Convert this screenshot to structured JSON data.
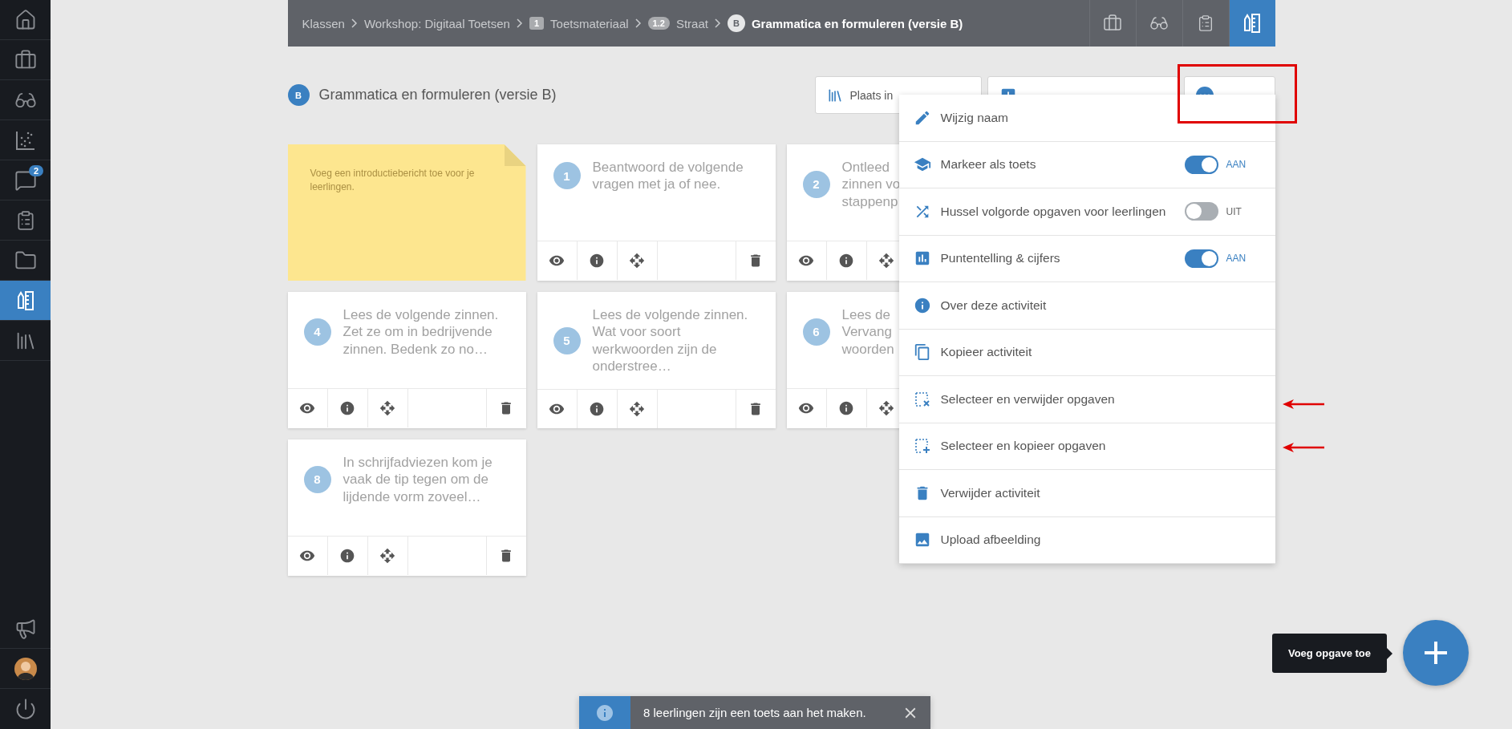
{
  "sidebar": {
    "items": [
      {
        "selected": false
      },
      {
        "selected": false
      },
      {
        "selected": false
      },
      {
        "selected": false
      },
      {
        "selected": false,
        "badge": "2"
      },
      {
        "selected": false
      },
      {
        "selected": false
      },
      {
        "selected": true
      },
      {
        "selected": false
      }
    ]
  },
  "header": {
    "breadcrumb": [
      {
        "label": "Klassen"
      },
      {
        "label": "Workshop: Digitaal Toetsen"
      },
      {
        "kind": "tag",
        "badge": "1",
        "label": "Toetsmateriaal"
      },
      {
        "kind": "tag",
        "badge": "1.2",
        "label": "Straat"
      },
      {
        "kind": "letter",
        "badge": "B",
        "label": "Grammatica en formuleren (versie B)",
        "current": true
      }
    ],
    "tools": [
      {
        "selected": false
      },
      {
        "selected": false
      },
      {
        "selected": false
      },
      {
        "selected": true
      }
    ]
  },
  "activity": {
    "badge": "B",
    "title": "Grammatica en formuleren (versie B)"
  },
  "actions": [
    {
      "label": "Plaats in"
    }
  ],
  "note": {
    "text": "Voeg een introductiebericht toe voor je leerlingen."
  },
  "cards": [
    {
      "number": "1",
      "text": "Beantwoord de volgende\nvragen met ja of nee."
    },
    {
      "number": "2",
      "text": "Ontleed\nzinnen vo\nstappenp"
    },
    {
      "number": "4",
      "text": "Lees de volgende zinnen.\nZet ze om in bedrijvende\nzinnen. Bedenk zo no…"
    },
    {
      "number": "5",
      "text": "Lees de volgende zinnen.\nWat voor soort\nwerkwoorden zijn de\nonderstree…"
    },
    {
      "number": "6",
      "text": "Lees de\nVervang\nwoorden"
    },
    {
      "number": "8",
      "text": "In schrijfadviezen kom je\nvaak de tip tegen om de\nlijdende vorm zoveel…"
    }
  ],
  "menu": {
    "items": [
      {
        "kind": "action",
        "label": "Wijzig naam"
      },
      {
        "kind": "toggle",
        "label": "Markeer als toets",
        "on": true,
        "state": "AAN"
      },
      {
        "kind": "toggle",
        "label": "Hussel volgorde opgaven voor leerlingen",
        "on": false,
        "state": "UIT"
      },
      {
        "kind": "toggle",
        "label": "Puntentelling & cijfers",
        "on": true,
        "state": "AAN"
      },
      {
        "kind": "action",
        "label": "Over deze activiteit"
      },
      {
        "kind": "action",
        "label": "Kopieer activiteit"
      },
      {
        "kind": "action",
        "label": "Selecteer en verwijder opgaven"
      },
      {
        "kind": "action",
        "label": "Selecteer en kopieer opgaven"
      },
      {
        "kind": "action",
        "label": "Verwijder activiteit"
      },
      {
        "kind": "action",
        "label": "Upload afbeelding"
      }
    ]
  },
  "toast": {
    "text": "8 leerlingen zijn een toets aan het maken."
  },
  "fab": {
    "tooltip": "Voeg opgave toe"
  }
}
